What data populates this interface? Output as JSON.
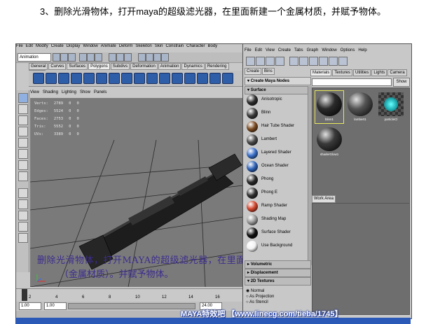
{
  "heading": "3、删除光滑物体，打开maya的超级滤光器，在里面新建一个金属材质，并赋予物体。",
  "maya": {
    "menus": [
      "File",
      "Edit",
      "Modify",
      "Create",
      "Display",
      "Window",
      "Animate",
      "Deform",
      "Skeleton",
      "Skin",
      "Constrain",
      "Character",
      "Body"
    ],
    "mode": "Animation",
    "shelf_tabs": [
      "General",
      "Curves",
      "Surfaces",
      "Polygons",
      "Subdivs",
      "Deformation",
      "Animation",
      "Dynamics",
      "Rendering",
      "PaintE"
    ],
    "active_shelf_tab": "Polygons",
    "panel_menus": [
      "View",
      "Shading",
      "Lighting",
      "Show",
      "Panels"
    ],
    "stats": [
      {
        "label": "Verts:",
        "a": "2789",
        "b": "0",
        "c": "0"
      },
      {
        "label": "Edges:",
        "a": "5524",
        "b": "0",
        "c": "0"
      },
      {
        "label": "Faces:",
        "a": "2753",
        "b": "0",
        "c": "0"
      },
      {
        "label": "Tris:",
        "a": "5552",
        "b": "0",
        "c": "0"
      },
      {
        "label": "UVs:",
        "a": "3389",
        "b": "0",
        "c": "0"
      }
    ],
    "caption_line1": "删除光滑物体，打开MAYA的超级滤光器，在里面新建一个金属材质",
    "caption_line2": "（金属材质）。并赋予物体。",
    "time_ticks": [
      "2",
      "4",
      "6",
      "8",
      "10",
      "12",
      "14",
      "16"
    ],
    "range_start": "1.00",
    "range_start2": "1.00",
    "range_end": "24.00"
  },
  "hypershade": {
    "menus": [
      "File",
      "Edit",
      "View",
      "Create",
      "Tabs",
      "Graph",
      "Window",
      "Options",
      "Help"
    ],
    "create_tabs": [
      "Create",
      "Bins"
    ],
    "create_header": "Create Maya Nodes",
    "section_surface": "Surface",
    "shaders": [
      {
        "name": "Anisotropic",
        "color": "#2e2e2e"
      },
      {
        "name": "Blinn",
        "color": "#3a3a3a"
      },
      {
        "name": "Hair Tube Shader",
        "color": "#7a4a22"
      },
      {
        "name": "Lambert",
        "color": "#4a4a4a"
      },
      {
        "name": "Layered Shader",
        "color": "#3a6fc9"
      },
      {
        "name": "Ocean Shader",
        "color": "#2f63b8"
      },
      {
        "name": "Phong",
        "color": "#2a2a2a"
      },
      {
        "name": "Phong E",
        "color": "#303030"
      },
      {
        "name": "Ramp Shader",
        "color": "#d2472f"
      },
      {
        "name": "Shading Map",
        "color": "#9a9a9a"
      },
      {
        "name": "Surface Shader",
        "color": "#111111"
      },
      {
        "name": "Use Background",
        "color": "#f2f2f2"
      }
    ],
    "section_volumetric": "Volumetric",
    "section_displacement": "Displacement",
    "section_2d": "2D Textures",
    "texture_options": [
      "Normal",
      "As Projection",
      "As Stencil"
    ],
    "tabs": [
      "Materials",
      "Textures",
      "Utilities",
      "Lights",
      "Camera"
    ],
    "active_tab": "Materials",
    "show_label": "Show",
    "materials": [
      {
        "name": "blinn1",
        "color": "#2b2b2b"
      },
      {
        "name": "lambert1",
        "color": "#555555"
      },
      {
        "name": "particleCl",
        "color": "#1aa3a8"
      },
      {
        "name": "shaderGlow1",
        "color": "#3a3a3a"
      }
    ],
    "work_area_label": "Work Area"
  },
  "watermark": "MAYA特效吧 【www.linecg.com/tieba/1745】"
}
